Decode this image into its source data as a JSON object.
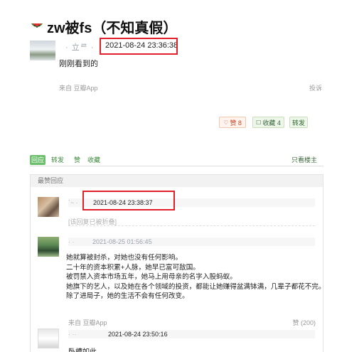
{
  "topic": {
    "title": "zw被fs（不知真假）",
    "icon": "watermelon-icon"
  },
  "post": {
    "author": "· 立ᄅ ·",
    "time": "2021-08-24 23:36:38",
    "body": "刚刚看到的",
    "source": "来自 豆瓣App",
    "report": "投诉"
  },
  "actions": {
    "like": "赞 8",
    "favorite": "收藏 4",
    "share": "转发"
  },
  "tabs": {
    "reply": "回应",
    "forward": "转发",
    "like": "赞",
    "favorite": "收藏",
    "only_op": "只看楼主"
  },
  "hot_replies": {
    "header": "最赞回应",
    "items": [
      {
        "author": "`~ ·",
        "time": "2021-08-24 23:38:37",
        "deleted_note": "[该回复已被折叠]"
      },
      {
        "author": "· ·",
        "time": "2021-08-25 01:56:45",
        "lines": [
          "她就算被封杀，对她也没有任何影响。",
          "二十年的资本积累+人脉，她早已富可敌国。",
          "被罚禁入资本市场五年，她马上用母亲的名字入股蚂蚁。",
          "她旗下的艺人，以及她在各个领域的投资，都能让她赚得盆满钵满，几辈子都花不完。",
          "除了进局子，她的生活不会有任何改变。"
        ],
        "source": "来自 豆瓣App",
        "votes": "赞 (200)"
      },
      {
        "author": "· ··",
        "time": "2021-08-24 23:50:16",
        "body": "卧槽如此"
      }
    ]
  },
  "colors": {
    "highlight_box": "#e0202a",
    "green_accent": "#6cbf6c",
    "like_text": "#c84a2c"
  }
}
